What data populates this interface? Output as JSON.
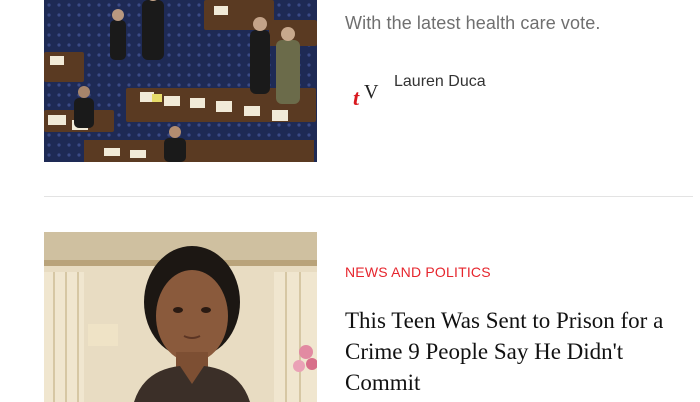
{
  "articles": [
    {
      "teaser": "With the latest health care vote.",
      "author": {
        "name": "Lauren Duca",
        "logo_letters": "tV"
      },
      "image_icon": "senate-floor-photo"
    },
    {
      "category": "NEWS AND POLITICS",
      "headline": "This Teen Was Sent to Prison for a Crime 9 People Say He Didn't Commit",
      "image_icon": "teen-portrait-photo"
    }
  ],
  "colors": {
    "category_red": "#e6252d",
    "teaser_gray": "#6f6f6f",
    "divider": "#e3e3e3",
    "logo_red": "#d9191f"
  }
}
